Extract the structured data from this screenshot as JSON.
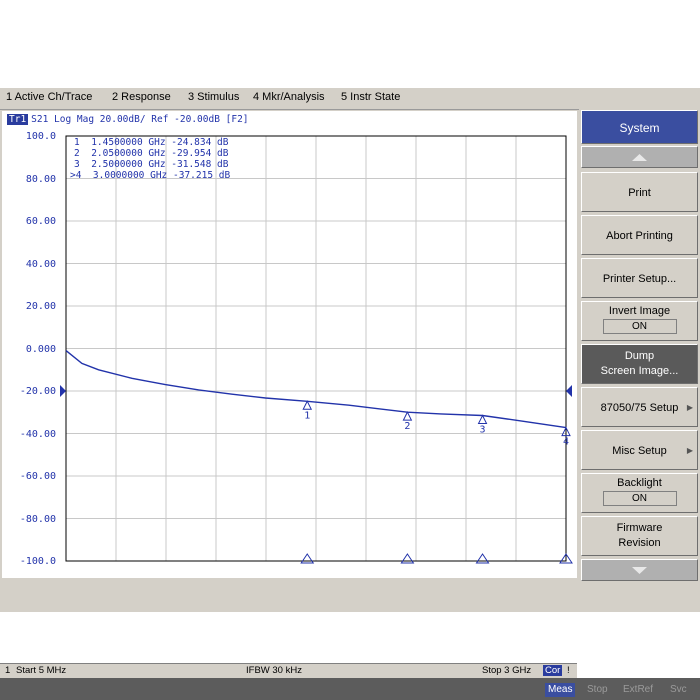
{
  "menubar": {
    "items": [
      "1 Active Ch/Trace",
      "2 Response",
      "3 Stimulus",
      "4 Mkr/Analysis",
      "5 Instr State"
    ]
  },
  "trace": {
    "tag": "Tr1",
    "header": "S21 Log Mag 20.00dB/ Ref -20.00dB [F2]"
  },
  "markers_table": [
    {
      "label": "1",
      "freq": "1.4500000 GHz",
      "value": "-24.834 dB"
    },
    {
      "label": "2",
      "freq": "2.0500000 GHz",
      "value": "-29.954 dB"
    },
    {
      "label": "3",
      "freq": "2.5000000 GHz",
      "value": "-31.548 dB"
    },
    {
      "label": ">4",
      "freq": "3.0000000 GHz",
      "value": "-37.215 dB"
    }
  ],
  "chart_data": {
    "type": "line",
    "xlabel": "",
    "ylabel": "",
    "xlim_ghz": [
      0.005,
      3.0
    ],
    "ylim": [
      -100,
      100
    ],
    "yticks": [
      "100.0",
      "80.00",
      "60.00",
      "40.00",
      "20.00",
      "0.000",
      "-20.00",
      "-40.00",
      "-60.00",
      "-80.00",
      "-100.0"
    ],
    "grid": true,
    "reference_level_db": -20,
    "series": [
      {
        "x": [
          0.005,
          0.1,
          0.2,
          0.4,
          0.6,
          0.8,
          1.0,
          1.2,
          1.45,
          1.7,
          2.05,
          2.25,
          2.5,
          2.75,
          3.0
        ],
        "values": [
          -1,
          -7,
          -10,
          -14,
          -17,
          -19.5,
          -21.5,
          -23.3,
          -24.834,
          -26.7,
          -29.954,
          -30.8,
          -31.548,
          -34.3,
          -37.215
        ],
        "color": "#2233aa"
      }
    ],
    "markers": [
      {
        "label": "1",
        "x": 1.45,
        "y": -24.834
      },
      {
        "label": "2",
        "x": 2.05,
        "y": -29.954
      },
      {
        "label": "3",
        "x": 2.5,
        "y": -31.548
      },
      {
        "label": "4",
        "x": 3.0,
        "y": -37.215
      }
    ]
  },
  "softkeys": {
    "title": "System",
    "print": "Print",
    "abort": "Abort Printing",
    "printer_setup": "Printer Setup...",
    "invert_label": "Invert Image",
    "invert_value": "ON",
    "dump_1": "Dump",
    "dump_2": "Screen Image...",
    "setup_87050": "87050/75 Setup",
    "misc_setup": "Misc Setup",
    "backlight_label": "Backlight",
    "backlight_value": "ON",
    "firmware_1": "Firmware",
    "firmware_2": "Revision"
  },
  "statusbar": {
    "channel": "1",
    "start": "Start 5 MHz",
    "ifbw": "IFBW 30 kHz",
    "stop": "Stop 3 GHz",
    "cor": "Cor",
    "end": "!"
  },
  "indicators": [
    "Meas",
    "Stop",
    "ExtRef",
    "Svc"
  ],
  "colors": {
    "trace": "#2233aa",
    "accent": "#3a4ea0",
    "background": "#d4d0c8"
  }
}
